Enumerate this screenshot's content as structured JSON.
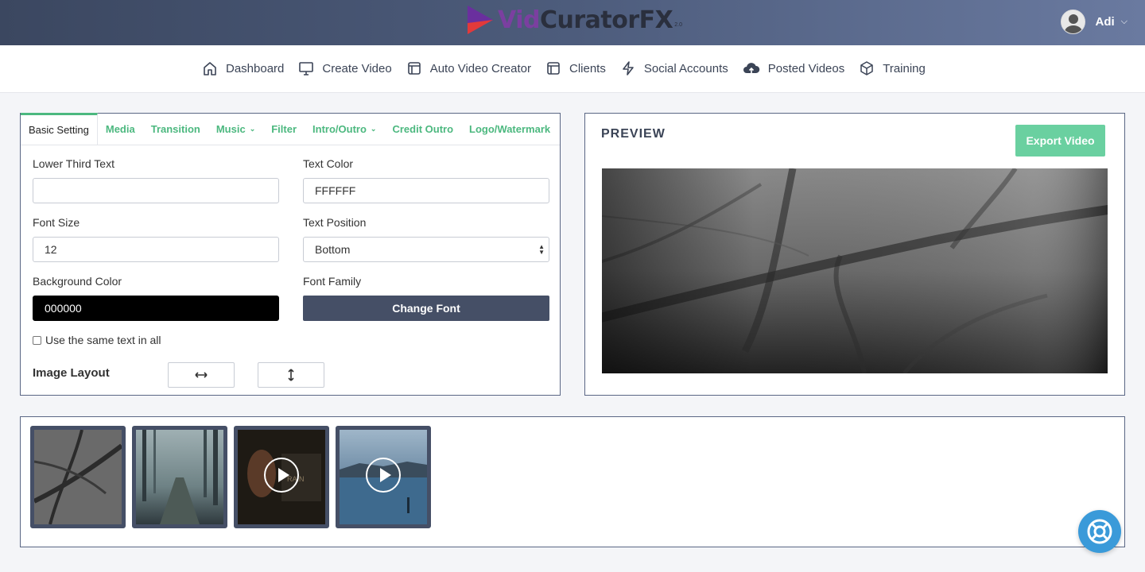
{
  "header": {
    "logo": {
      "vid": "Vid",
      "curator": "Curator",
      "fx": "FX",
      "sub": "2.0"
    },
    "user": {
      "name": "Adi"
    }
  },
  "nav": [
    {
      "label": "Dashboard",
      "icon": "home-icon"
    },
    {
      "label": "Create Video",
      "icon": "monitor-icon"
    },
    {
      "label": "Auto Video Creator",
      "icon": "layout-icon"
    },
    {
      "label": "Clients",
      "icon": "layout-icon"
    },
    {
      "label": "Social Accounts",
      "icon": "lightning-icon"
    },
    {
      "label": "Posted Videos",
      "icon": "cloud-upload-icon"
    },
    {
      "label": "Training",
      "icon": "box-icon"
    }
  ],
  "tabs": [
    {
      "label": "Basic Setting",
      "active": true
    },
    {
      "label": "Media"
    },
    {
      "label": "Transition"
    },
    {
      "label": "Music",
      "dropdown": true
    },
    {
      "label": "Filter"
    },
    {
      "label": "Intro/Outro",
      "dropdown": true
    },
    {
      "label": "Credit Outro"
    },
    {
      "label": "Logo/Watermark"
    }
  ],
  "form": {
    "lower_third_label": "Lower Third Text",
    "lower_third_value": "",
    "text_color_label": "Text Color",
    "text_color_value": "FFFFFF",
    "font_size_label": "Font Size",
    "font_size_value": "12",
    "text_position_label": "Text Position",
    "text_position_value": "Bottom",
    "bg_color_label": "Background Color",
    "bg_color_value": "000000",
    "font_family_label": "Font Family",
    "change_font_label": "Change Font",
    "same_text_label": "Use the same text in all",
    "same_text_checked": false,
    "image_layout_label": "Image Layout"
  },
  "preview": {
    "title": "PREVIEW",
    "export_label": "Export Video"
  },
  "media": [
    {
      "name": "leaf-thumbnail",
      "type": "image"
    },
    {
      "name": "foggy-forest-thumbnail",
      "type": "image"
    },
    {
      "name": "rain-video-thumbnail",
      "type": "video"
    },
    {
      "name": "lake-video-thumbnail",
      "type": "video"
    }
  ],
  "colors": {
    "accent_green": "#4cb87f",
    "export_green": "#6ad0a0",
    "dark_button": "#454f66",
    "help_blue": "#3a9ad9"
  }
}
